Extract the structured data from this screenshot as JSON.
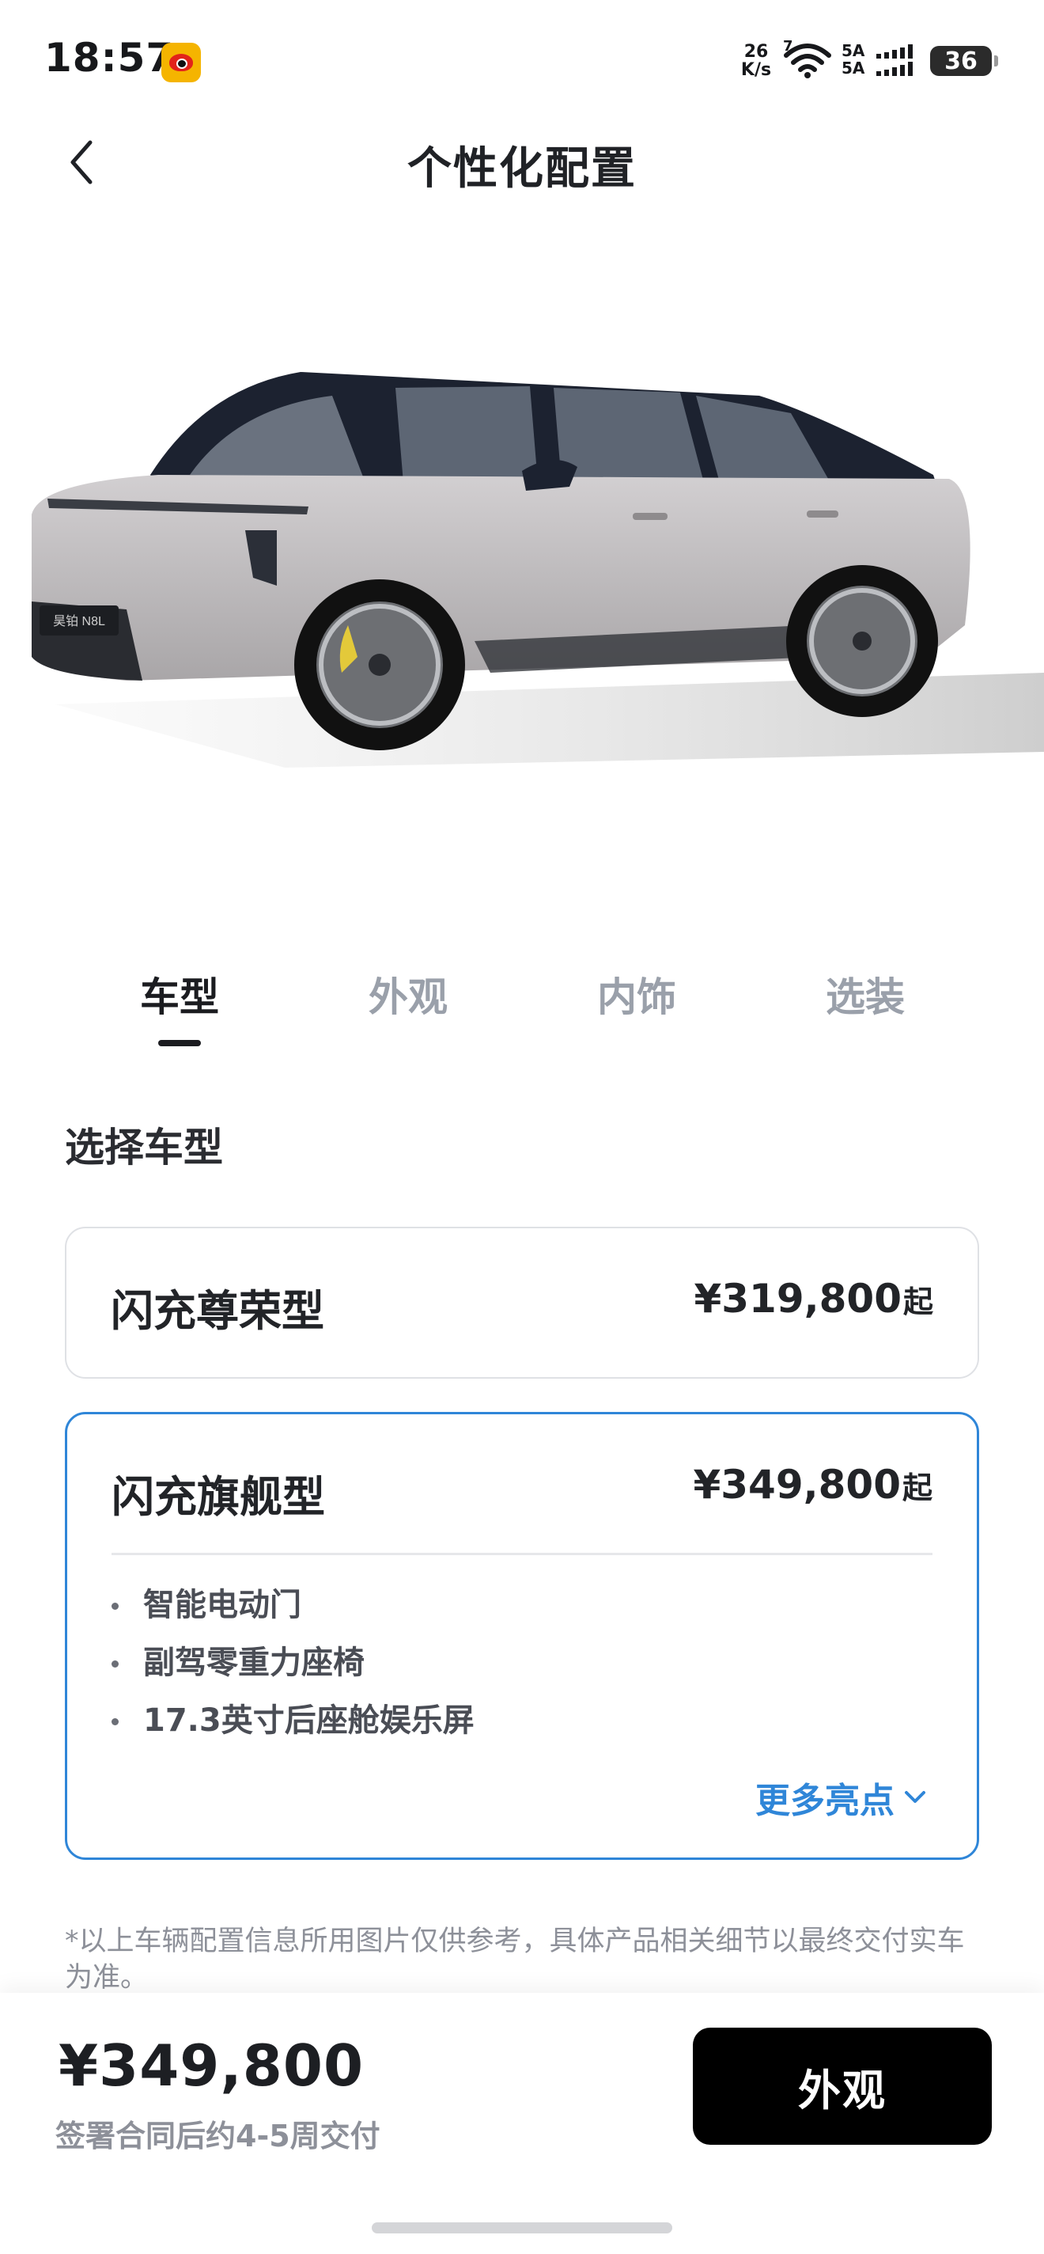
{
  "status_bar": {
    "time": "18:57",
    "net_speed_value": "26",
    "net_speed_unit": "K/s",
    "wifi_label": "7",
    "sim_1_label": "5A",
    "sim_2_label": "5A",
    "battery_level": "36",
    "notification_icon": "weibo-icon"
  },
  "header": {
    "title": "个性化配置",
    "back_icon": "chevron-left-icon"
  },
  "car_image": {
    "badge_text": "昊铂 N8L",
    "body_color": "#b9b6b8",
    "roof_color": "#1c2230",
    "caliper_color": "#e3c93a"
  },
  "tabs": [
    {
      "label": "车型",
      "active": true
    },
    {
      "label": "外观",
      "active": false
    },
    {
      "label": "内饰",
      "active": false
    },
    {
      "label": "选装",
      "active": false
    }
  ],
  "section": {
    "title": "选择车型"
  },
  "trims": [
    {
      "name": "闪充尊荣型",
      "price": "¥319,800",
      "price_suffix": "起",
      "selected": false
    },
    {
      "name": "闪充旗舰型",
      "price": "¥349,800",
      "price_suffix": "起",
      "selected": true,
      "features": [
        "智能电动门",
        "副驾零重力座椅",
        "17.3英寸后座舱娱乐屏"
      ],
      "more_label": "更多亮点"
    }
  ],
  "disclaimer": "*以上车辆配置信息所用图片仅供参考，具体产品相关细节以最终交付实车为准。",
  "bottom_bar": {
    "total_price": "¥349,800",
    "delivery_note": "签署合同后约4-5周交付",
    "cta_label": "外观"
  },
  "colors": {
    "accent": "#2f86d8",
    "text_primary": "#222428",
    "text_muted": "#9aa0aa",
    "cta_background": "#000000"
  }
}
